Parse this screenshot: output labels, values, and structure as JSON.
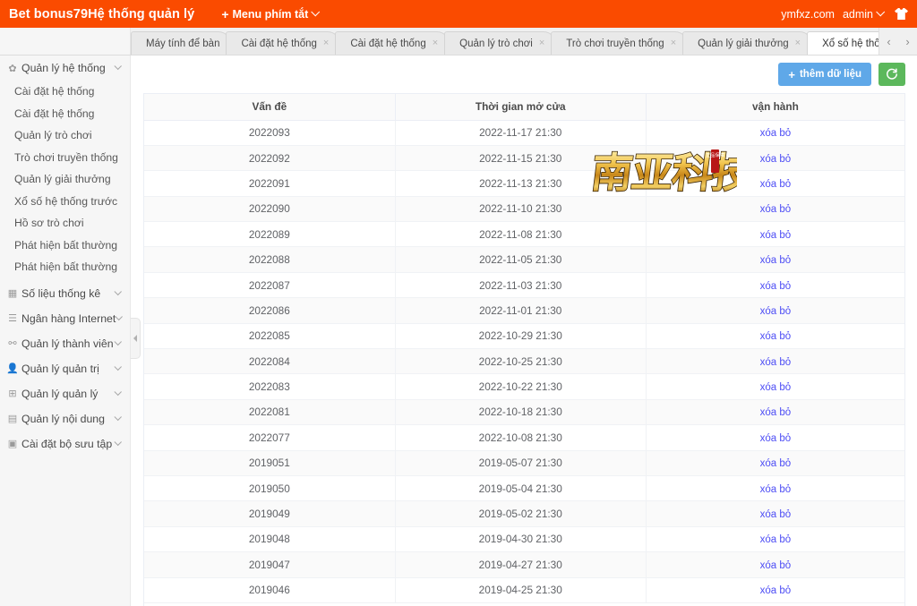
{
  "header": {
    "brand": "Bet bonus79Hệ thống quản lý",
    "shortcut_menu": "Menu phím tắt",
    "plus": "+",
    "domain": "ymfxz.com",
    "user": "admin",
    "skin_icon": "tshirt-icon"
  },
  "tabs": {
    "items": [
      {
        "label": "Máy tính để bàn",
        "closable": false,
        "active": false
      },
      {
        "label": "Cài đặt hệ thống",
        "closable": true,
        "active": false
      },
      {
        "label": "Cài đặt hệ thống",
        "closable": true,
        "active": false
      },
      {
        "label": "Quản lý trò chơi",
        "closable": true,
        "active": false
      },
      {
        "label": "Trò chơi truyền thống",
        "closable": true,
        "active": false
      },
      {
        "label": "Quản lý giải thưởng",
        "closable": true,
        "active": false
      },
      {
        "label": "Xổ số hệ thống",
        "closable": false,
        "active": true
      }
    ],
    "prev": "‹",
    "next": "›",
    "close_glyph": "×"
  },
  "sidebar": {
    "groups": [
      {
        "icon": "gear-icon",
        "glyph": "✿",
        "label": "Quản lý hệ thống",
        "expanded": true,
        "items": [
          "Cài đặt hệ thống",
          "Cài đặt hệ thống",
          "Quản lý trò chơi",
          "Trò chơi truyền thống",
          "Quản lý giải thưởng",
          "Xổ số hệ thống trước",
          "Hồ sơ trò chơi",
          "Phát hiện bất thường",
          "Phát hiện bất thường"
        ]
      },
      {
        "icon": "chart-icon",
        "glyph": "▦",
        "label": "Số liệu thống kê",
        "expanded": false,
        "items": []
      },
      {
        "icon": "list-icon",
        "glyph": "☰",
        "label": "Ngân hàng Internet",
        "expanded": false,
        "items": []
      },
      {
        "icon": "users-icon",
        "glyph": "⚯",
        "label": "Quản lý thành viên",
        "expanded": false,
        "items": []
      },
      {
        "icon": "user-icon",
        "glyph": "👤",
        "label": "Quản lý quản trị",
        "expanded": false,
        "items": []
      },
      {
        "icon": "grid-icon",
        "glyph": "⊞",
        "label": "Quản lý quản lý",
        "expanded": false,
        "items": []
      },
      {
        "icon": "document-icon",
        "glyph": "▤",
        "label": "Quản lý nội dung",
        "expanded": false,
        "items": []
      },
      {
        "icon": "folder-icon",
        "glyph": "▣",
        "label": "Cài đặt bộ sưu tập",
        "expanded": false,
        "items": []
      }
    ],
    "collapse_handle": "collapse-sidebar-handle"
  },
  "toolbar": {
    "add_label": "thêm dữ liệu",
    "add_plus": "+",
    "refresh_icon": "refresh-icon"
  },
  "table": {
    "columns": [
      "Vấn đề",
      "Thời gian mở cửa",
      "vận hành"
    ],
    "action_label": "xóa bỏ",
    "rows": [
      {
        "issue": "2022093",
        "open_time": "2022-11-17 21:30"
      },
      {
        "issue": "2022092",
        "open_time": "2022-11-15 21:30"
      },
      {
        "issue": "2022091",
        "open_time": "2022-11-13 21:30"
      },
      {
        "issue": "2022090",
        "open_time": "2022-11-10 21:30"
      },
      {
        "issue": "2022089",
        "open_time": "2022-11-08 21:30"
      },
      {
        "issue": "2022088",
        "open_time": "2022-11-05 21:30"
      },
      {
        "issue": "2022087",
        "open_time": "2022-11-03 21:30"
      },
      {
        "issue": "2022086",
        "open_time": "2022-11-01 21:30"
      },
      {
        "issue": "2022085",
        "open_time": "2022-10-29 21:30"
      },
      {
        "issue": "2022084",
        "open_time": "2022-10-25 21:30"
      },
      {
        "issue": "2022083",
        "open_time": "2022-10-22 21:30"
      },
      {
        "issue": "2022081",
        "open_time": "2022-10-18 21:30"
      },
      {
        "issue": "2022077",
        "open_time": "2022-10-08 21:30"
      },
      {
        "issue": "2019051",
        "open_time": "2019-05-07 21:30"
      },
      {
        "issue": "2019050",
        "open_time": "2019-05-04 21:30"
      },
      {
        "issue": "2019049",
        "open_time": "2019-05-02 21:30"
      },
      {
        "issue": "2019048",
        "open_time": "2019-04-30 21:30"
      },
      {
        "issue": "2019047",
        "open_time": "2019-04-27 21:30"
      },
      {
        "issue": "2019046",
        "open_time": "2019-04-25 21:30"
      }
    ]
  },
  "watermark": {
    "text": "南亚科技",
    "seal_text": "正品保障"
  },
  "colors": {
    "header_orange": "#fa4b00",
    "add_button_blue": "#5fa8e8",
    "refresh_green": "#5cb85c",
    "link_blue": "#4d4df5",
    "watermark_gold": "#e8b028"
  }
}
